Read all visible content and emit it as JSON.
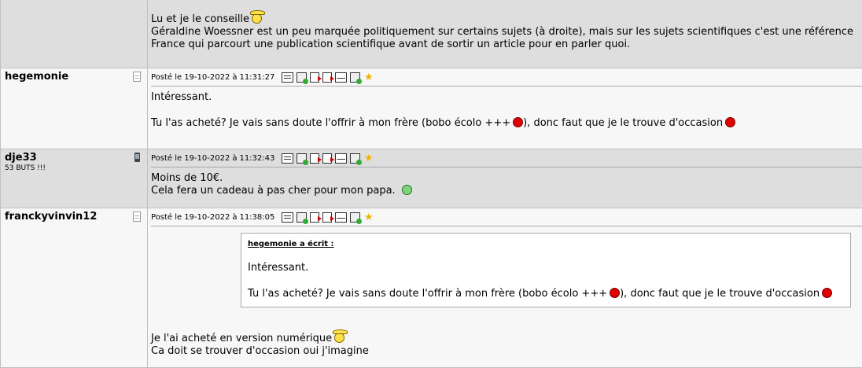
{
  "top_post": {
    "line1": "Lu et je le conseille",
    "line2": "Géraldine Woessner est un peu marquée politiquement sur certains sujets (à droite), mais sur les sujets scientifiques c'est une référence",
    "line3": "France qui parcourt une publication scientifique avant de sortir un article pour en parler quoi."
  },
  "posts": [
    {
      "author": "hegemonie",
      "subtitle": "",
      "posted_label": "Posté le",
      "date": "19-10-2022",
      "at": "à",
      "time": "11:31:27",
      "line1": "Intéressant.",
      "line2a": "Tu l'as acheté? Je vais sans doute l'offrir à mon frère (bobo écolo +++",
      "line2b": "), donc faut que je le trouve d'occasion"
    },
    {
      "author": "dje33",
      "subtitle": "53 BUTS !!!",
      "posted_label": "Posté le",
      "date": "19-10-2022",
      "at": "à",
      "time": "11:32:43",
      "line1": "Moins de 10€.",
      "line2": "Cela fera un cadeau à pas cher pour mon papa."
    },
    {
      "author": "franckyvinvin12",
      "subtitle": "",
      "posted_label": "Posté le",
      "date": "19-10-2022",
      "at": "à",
      "time": "11:38:05",
      "quote_header": "hegemonie a écrit :",
      "quote_line1": "Intéressant.",
      "quote_line2a": "Tu l'as acheté? Je vais sans doute l'offrir à mon frère (bobo écolo +++",
      "quote_line2b": "), donc faut que je le trouve d'occasion",
      "line1": "Je l'ai acheté en version numérique",
      "line2": "Ca doit se trouver d'occasion oui j'imagine"
    }
  ],
  "icons": {
    "profile": "profile-icon",
    "mobile": "mobile-icon",
    "smiley_red": "red-smiley-icon",
    "smiley_hat": "hat-smiley-icon",
    "smiley_green": "green-smiley-icon",
    "star": "star-icon"
  },
  "colors": {
    "row_gray": "#dedede",
    "row_white": "#f7f7f7",
    "smiley_red": "#e00000",
    "star": "#f0b400"
  }
}
